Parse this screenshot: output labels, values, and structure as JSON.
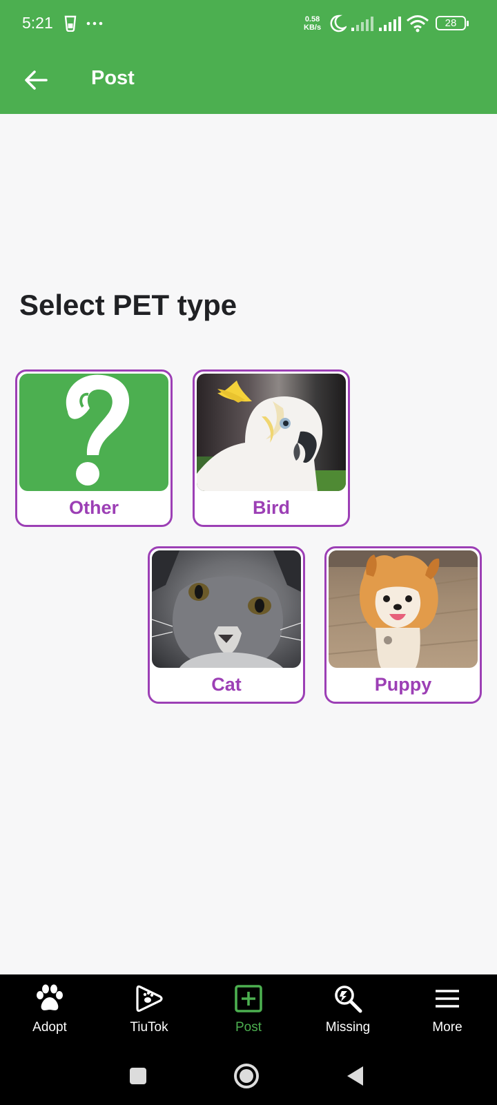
{
  "status_bar": {
    "time": "5:21",
    "network_speed_value": "0.58",
    "network_speed_unit": "KB/s",
    "battery": "28",
    "icons": [
      "sim-icon",
      "more-dots-icon",
      "moon-icon",
      "signal-icon",
      "signal-icon",
      "wifi-icon",
      "battery-icon"
    ]
  },
  "app_bar": {
    "title": "Post",
    "back_icon": "arrow-back-icon"
  },
  "main": {
    "heading": "Select PET type",
    "pet_types": [
      {
        "label": "Other",
        "image": "question-mark"
      },
      {
        "label": "Bird",
        "image": "cockatoo-photo"
      },
      {
        "label": "Cat",
        "image": "grey-cat-photo"
      },
      {
        "label": "Puppy",
        "image": "pomeranian-photo"
      }
    ]
  },
  "bottom_nav": {
    "items": [
      {
        "label": "Adopt",
        "icon": "paw-icon"
      },
      {
        "label": "TiuTok",
        "icon": "play-paw-icon"
      },
      {
        "label": "Post",
        "icon": "add-box-icon",
        "active": true
      },
      {
        "label": "Missing",
        "icon": "search-pet-icon"
      },
      {
        "label": "More",
        "icon": "menu-icon"
      }
    ],
    "active_color": "#4caf50"
  },
  "system_nav": {
    "icons": [
      "recents-square-icon",
      "home-circle-icon",
      "back-triangle-icon"
    ]
  },
  "colors": {
    "primary": "#4caf50",
    "accent": "#9c3fb5",
    "background": "#f7f7f8",
    "nav_background": "#000000"
  }
}
